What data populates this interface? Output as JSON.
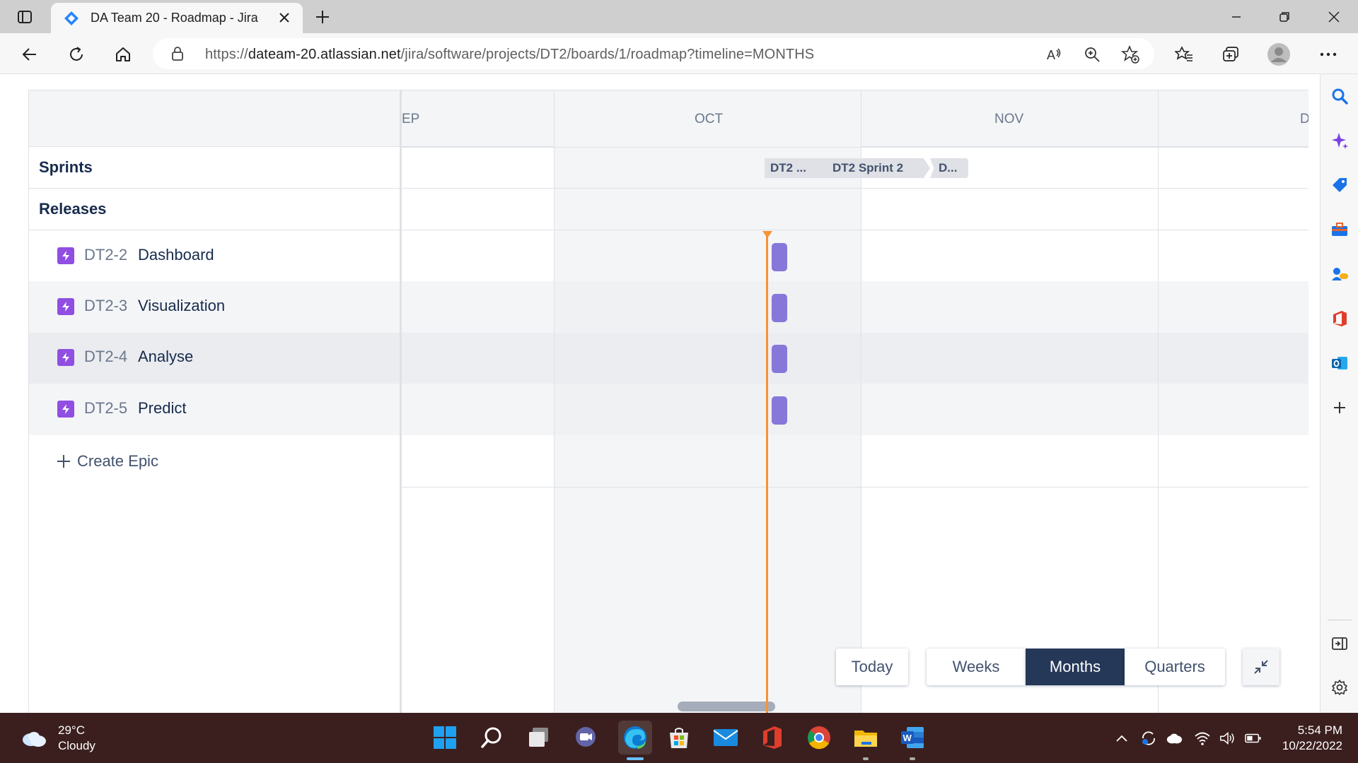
{
  "browser": {
    "tab_title": "DA Team 20 - Roadmap - Jira",
    "url_prefix": "https://",
    "url_host": "dateam-20.atlassian.net",
    "url_path": "/jira/software/projects/DT2/boards/1/roadmap?timeline=MONTHS"
  },
  "timeline": {
    "months": [
      "EP",
      "OCT",
      "NOV",
      "D"
    ],
    "sprints": [
      "DT2 ...",
      "DT2 Sprint 2",
      "D..."
    ]
  },
  "rows": {
    "sprints_label": "Sprints",
    "releases_label": "Releases"
  },
  "epics": [
    {
      "key": "DT2-2",
      "name": "Dashboard"
    },
    {
      "key": "DT2-3",
      "name": "Visualization"
    },
    {
      "key": "DT2-4",
      "name": "Analyse"
    },
    {
      "key": "DT2-5",
      "name": "Predict"
    }
  ],
  "create_epic_label": "Create Epic",
  "view_controls": {
    "today": "Today",
    "weeks": "Weeks",
    "months": "Months",
    "quarters": "Quarters",
    "selected": "Months"
  },
  "taskbar": {
    "temperature": "29°C",
    "condition": "Cloudy",
    "time": "5:54 PM",
    "date": "10/22/2022"
  },
  "colors": {
    "accent_dark": "#253858",
    "epic_purple": "#904ee2",
    "epic_bar": "#8777d9",
    "today_line": "#f79233"
  }
}
